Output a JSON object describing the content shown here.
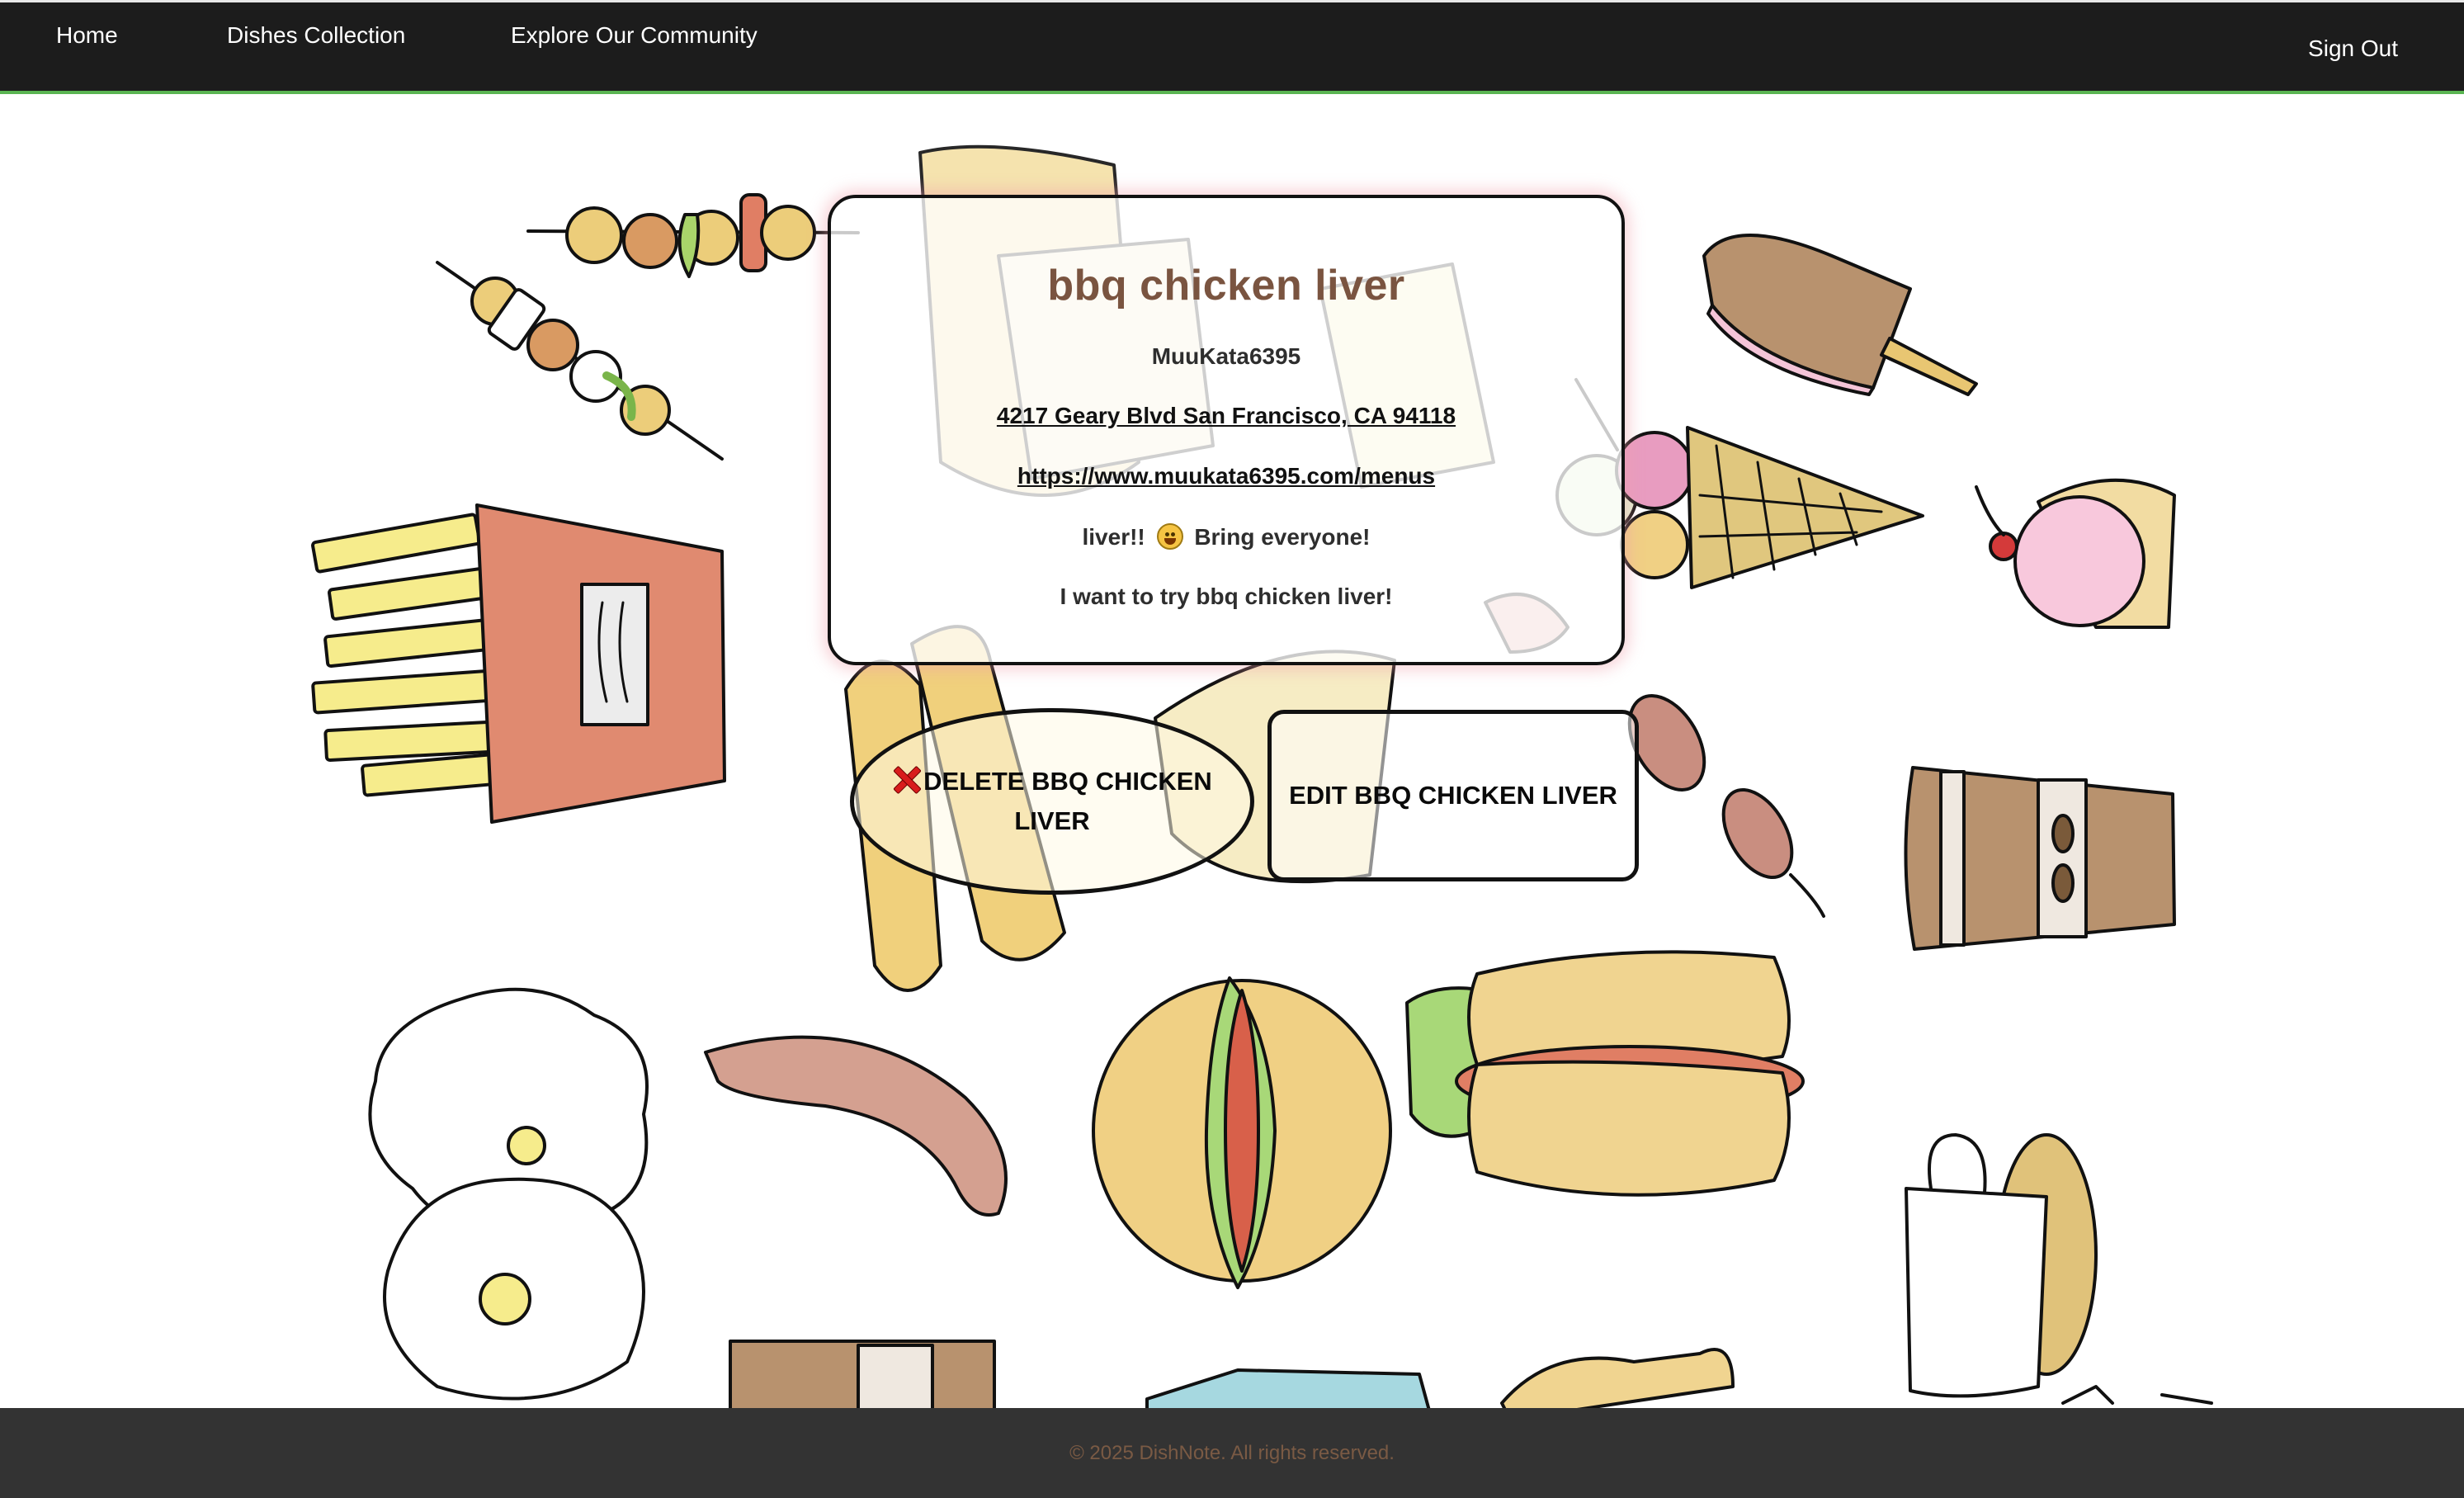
{
  "nav": {
    "home": "Home",
    "dishes": "Dishes Collection",
    "community": "Explore Our Community",
    "signout": "Sign Out"
  },
  "dish": {
    "title": "bbq chicken liver",
    "author": "MuuKata6395",
    "address": "4217 Geary Blvd San Francisco, CA 94118",
    "website": "https://www.muukata6395.com/menus",
    "description_before": "liver!!",
    "description_emoji": "grinning-face-emoji",
    "description_after": "Bring everyone!",
    "note": "I want to try bbq chicken liver!"
  },
  "actions": {
    "delete_label": "DELETE BBQ CHICKEN LIVER",
    "delete_icon": "red-x-icon",
    "edit_label": "EDIT BBQ CHICKEN LIVER"
  },
  "footer": {
    "copyright": "© 2025 DishNote. All rights reserved."
  },
  "colors": {
    "navbar": "#1c1c1c",
    "nav_accent": "#5ab552",
    "title": "#7a5440",
    "footer": "#333333",
    "footer_text": "#7a5a44",
    "delete_icon": "#d81c1c"
  }
}
